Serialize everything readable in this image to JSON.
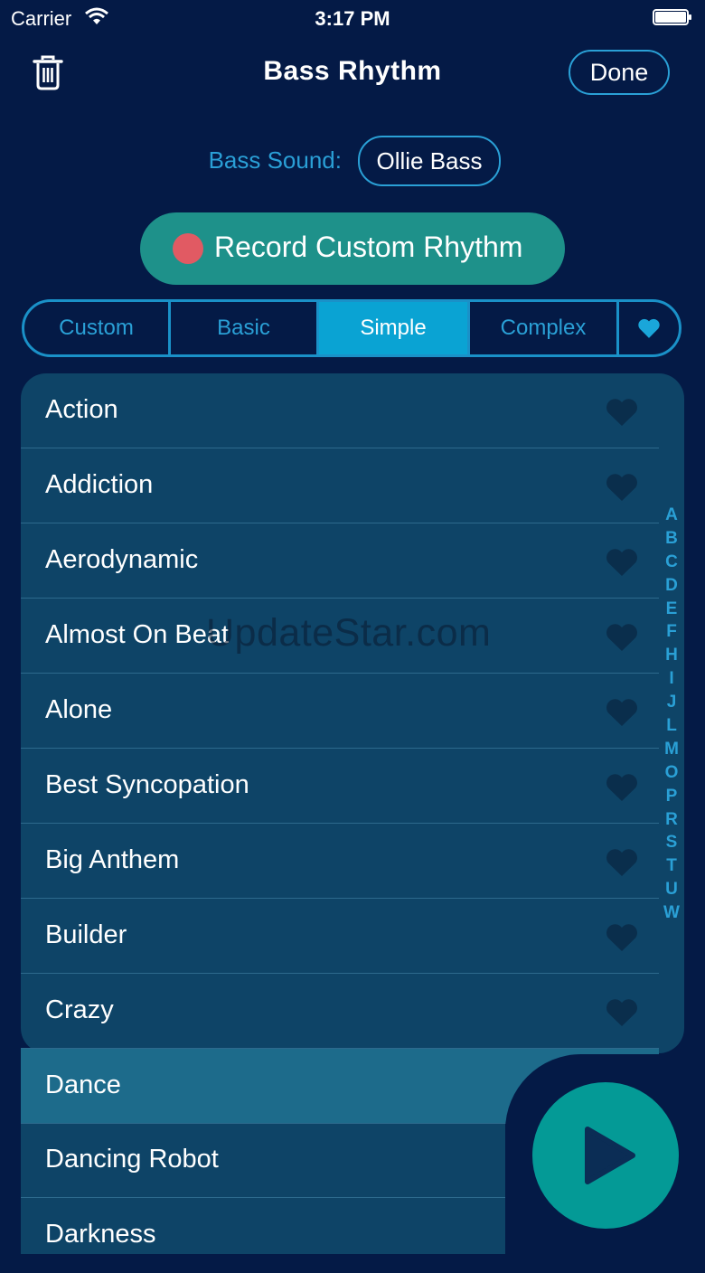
{
  "status_bar": {
    "carrier": "Carrier",
    "time": "3:17 PM",
    "wifi_icon": "wifi-icon",
    "battery_icon": "battery-icon"
  },
  "nav": {
    "title": "Bass Rhythm",
    "done_label": "Done",
    "trash_icon": "trash-icon"
  },
  "bass_sound": {
    "label": "Bass Sound:",
    "value": "Ollie Bass"
  },
  "record": {
    "label": "Record Custom Rhythm",
    "icon": "record-dot-icon",
    "dot_color": "#e15a63"
  },
  "tabs": [
    {
      "label": "Custom",
      "active": false
    },
    {
      "label": "Basic",
      "active": false
    },
    {
      "label": "Simple",
      "active": true
    },
    {
      "label": "Complex",
      "active": false
    },
    {
      "label": "",
      "icon": "heart-icon",
      "active": false
    }
  ],
  "rhythms": [
    {
      "name": "Action"
    },
    {
      "name": "Addiction"
    },
    {
      "name": "Aerodynamic"
    },
    {
      "name": "Almost On Beat"
    },
    {
      "name": "Alone"
    },
    {
      "name": "Best Syncopation"
    },
    {
      "name": "Big Anthem"
    },
    {
      "name": "Builder"
    },
    {
      "name": "Crazy"
    },
    {
      "name": "Dance",
      "selected": true
    },
    {
      "name": "Dancing Robot"
    },
    {
      "name": "Darkness"
    }
  ],
  "index_letters": [
    "A",
    "B",
    "C",
    "D",
    "E",
    "F",
    "H",
    "I",
    "J",
    "L",
    "M",
    "O",
    "P",
    "R",
    "S",
    "T",
    "U",
    "W"
  ],
  "play_button": {
    "icon": "play-icon"
  },
  "watermark": "UpdateStar.com",
  "colors": {
    "background": "#041a46",
    "list_background": "#0e4467",
    "accent": "#2aa0d6",
    "active_tab": "#0aa3d3",
    "record_button": "#1e918a",
    "play_button": "#049a96",
    "selected_row": "#1d6b8b"
  }
}
